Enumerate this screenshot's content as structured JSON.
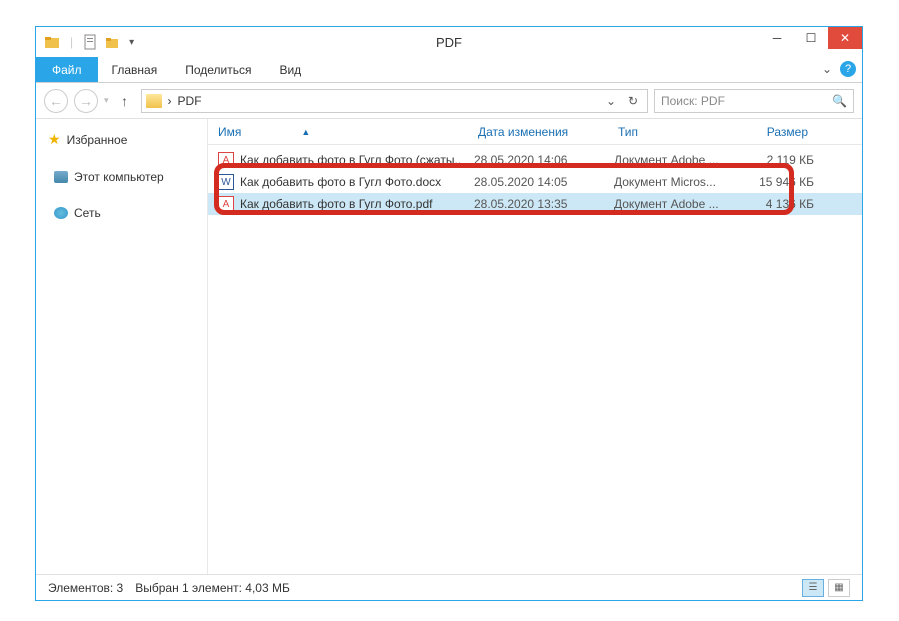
{
  "title": "PDF",
  "ribbon": {
    "file": "Файл",
    "tabs": [
      "Главная",
      "Поделиться",
      "Вид"
    ]
  },
  "breadcrumb": {
    "current": "PDF",
    "arrow": "›"
  },
  "search": {
    "placeholder": "Поиск: PDF"
  },
  "nav": {
    "favorites": "Избранное",
    "computer": "Этот компьютер",
    "network": "Сеть"
  },
  "columns": {
    "name": "Имя",
    "date": "Дата изменения",
    "type": "Тип",
    "size": "Размер"
  },
  "files": [
    {
      "icon": "pdf",
      "name": "Как добавить фото в Гугл Фото (сжаты..",
      "date": "28.05.2020 14:06",
      "type": "Документ Adobe ...",
      "size": "2 119 КБ",
      "selected": false
    },
    {
      "icon": "doc",
      "name": "Как добавить фото в Гугл Фото.docx",
      "date": "28.05.2020 14:05",
      "type": "Документ Micros...",
      "size": "15 946 КБ",
      "selected": false
    },
    {
      "icon": "pdf",
      "name": "Как добавить фото в Гугл Фото.pdf",
      "date": "28.05.2020 13:35",
      "type": "Документ Adobe ...",
      "size": "4 136 КБ",
      "selected": true
    }
  ],
  "status": {
    "count": "Элементов: 3",
    "selection": "Выбран 1 элемент: 4,03 МБ"
  }
}
